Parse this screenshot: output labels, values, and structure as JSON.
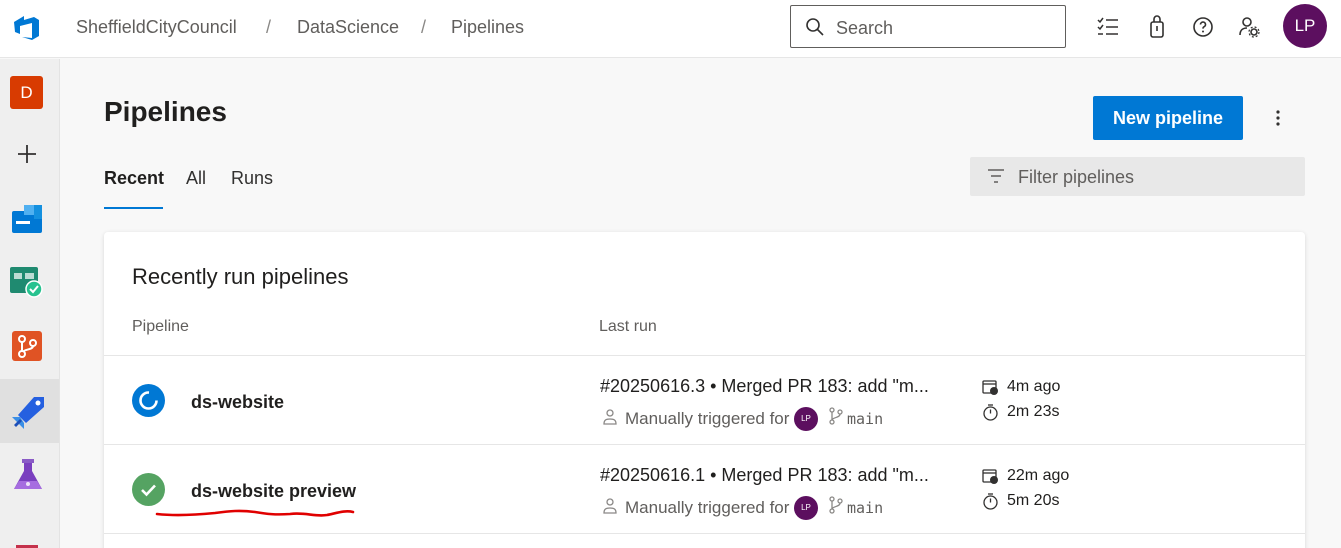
{
  "header": {
    "breadcrumb": [
      "SheffieldCityCouncil",
      "DataScience",
      "Pipelines"
    ],
    "separator": "/",
    "search_placeholder": "Search",
    "user_initials": "LP",
    "icons": [
      "work-items-icon",
      "marketplace-bag-icon",
      "help-icon",
      "user-settings-icon"
    ]
  },
  "sidebar": {
    "project_initial": "D",
    "items": [
      "project-badge",
      "add-icon",
      "boards-icon",
      "test-plans-icon",
      "repos-icon",
      "pipelines-icon",
      "artifacts-icon",
      "more-icon"
    ],
    "active": "pipelines-icon"
  },
  "page": {
    "title": "Pipelines",
    "new_button": "New pipeline",
    "tabs": [
      "Recent",
      "All",
      "Runs"
    ],
    "active_tab": "Recent",
    "filter_placeholder": "Filter pipelines"
  },
  "card": {
    "title": "Recently run pipelines",
    "columns": [
      "Pipeline",
      "Last run"
    ],
    "rows": [
      {
        "status": "running",
        "name": "ds-website",
        "run": "#20250616.3 • Merged PR 183: add \"m...",
        "trigger": "Manually triggered for",
        "trigger_user": "LP",
        "branch": "main",
        "ago": "4m ago",
        "duration": "2m 23s"
      },
      {
        "status": "succeeded",
        "name": "ds-website preview",
        "run": "#20250616.1 • Merged PR 183: add \"m...",
        "trigger": "Manually triggered for",
        "trigger_user": "LP",
        "branch": "main",
        "ago": "22m ago",
        "duration": "5m 20s"
      }
    ]
  },
  "colors": {
    "accent": "#0078d4",
    "avatar": "#5c0f5f",
    "success": "#55a362",
    "project": "#d83b01",
    "annotation": "#e00000"
  }
}
